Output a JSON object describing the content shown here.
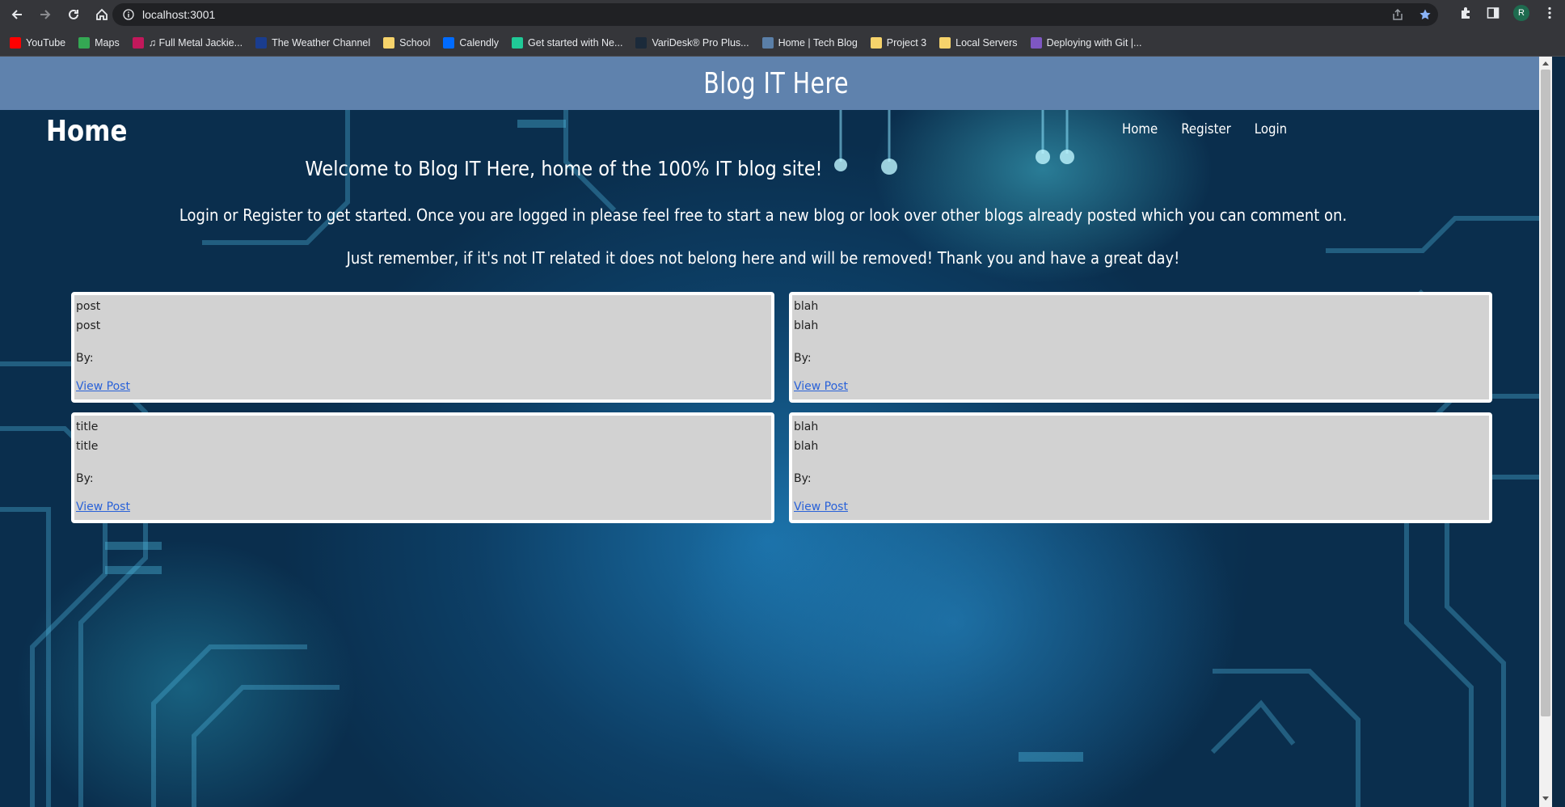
{
  "browser": {
    "url": "localhost:3001",
    "avatar_letter": "R",
    "bookmarks": [
      {
        "label": "YouTube",
        "color": "#ff0000"
      },
      {
        "label": "Maps",
        "color": "#34a853"
      },
      {
        "label": "♫ Full Metal Jackie...",
        "color": "#c2185b"
      },
      {
        "label": "The Weather Channel",
        "color": "#1a3d8f"
      },
      {
        "label": "School",
        "color": "#f6d36b"
      },
      {
        "label": "Calendly",
        "color": "#006bff"
      },
      {
        "label": "Get started with Ne...",
        "color": "#20c997"
      },
      {
        "label": "VariDesk® Pro Plus...",
        "color": "#1b2a3a"
      },
      {
        "label": "Home | Tech Blog",
        "color": "#5a7fa8"
      },
      {
        "label": "Project 3",
        "color": "#f6d36b"
      },
      {
        "label": "Local Servers",
        "color": "#f6d36b"
      },
      {
        "label": "Deploying with Git |...",
        "color": "#7e57c2"
      }
    ]
  },
  "site": {
    "title": "Blog IT Here",
    "page_heading": "Home",
    "nav": [
      "Home",
      "Register",
      "Login"
    ],
    "welcome": "Welcome to Blog IT Here, home of the 100% IT blog site!",
    "intro_line1": "Login or Register to get started. Once you are logged in please feel free to start a new blog or look over other blogs already posted which you can comment on.",
    "intro_line2": "Just remember, if it's not IT related it does not belong here and will be removed! Thank you and have a great day!"
  },
  "posts": [
    {
      "title": "post",
      "body": "post",
      "by": "By:",
      "link": "View Post"
    },
    {
      "title": "blah",
      "body": "blah",
      "by": "By:",
      "link": "View Post"
    },
    {
      "title": "title",
      "body": "title",
      "by": "By:",
      "link": "View Post"
    },
    {
      "title": "blah",
      "body": "blah",
      "by": "By:",
      "link": "View Post"
    }
  ]
}
